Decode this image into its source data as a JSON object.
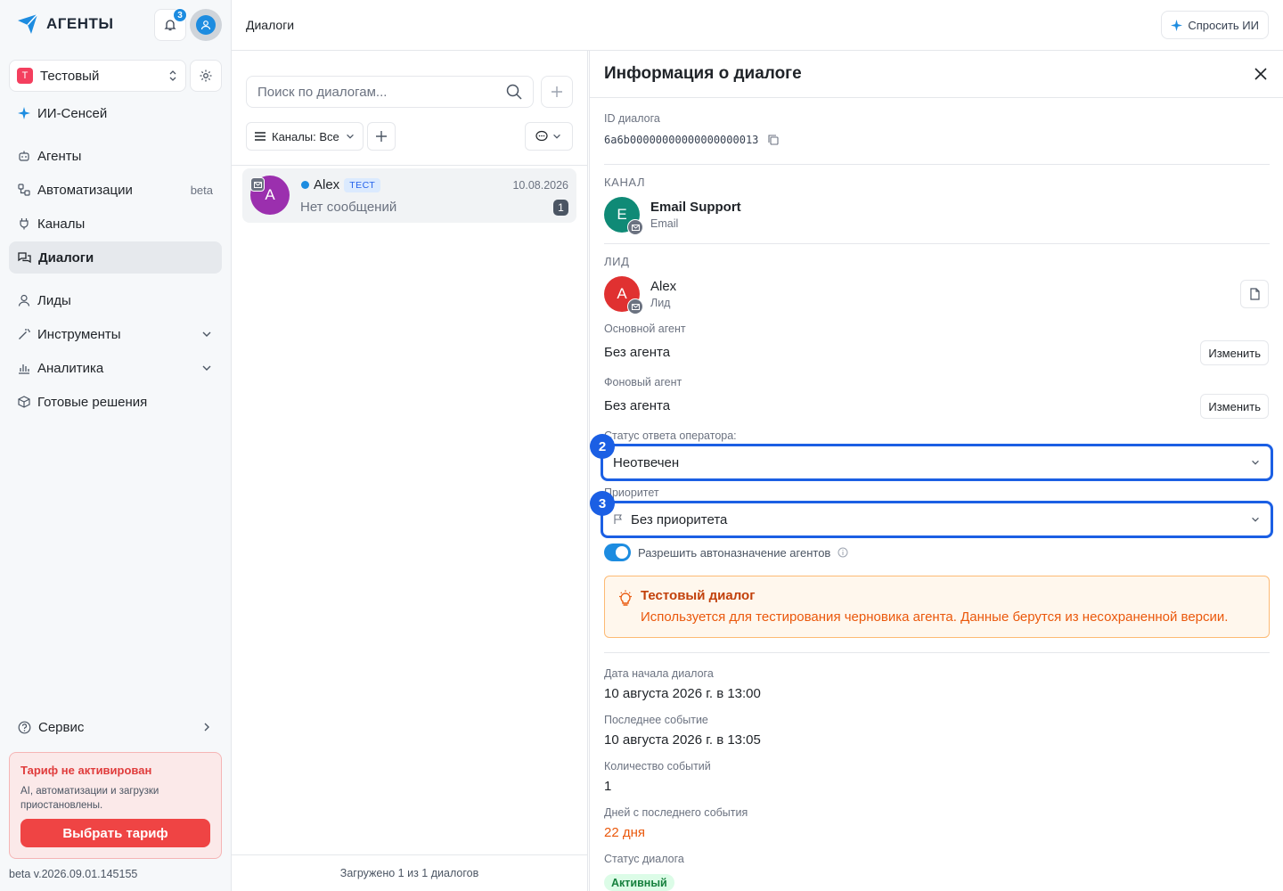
{
  "app": {
    "logo_text": "АГЕНТЫ",
    "notifications_count": "3"
  },
  "workspace": {
    "badge": "T",
    "name": "Тестовый"
  },
  "nav": {
    "ai_sensei": "ИИ-Сенсей",
    "agents": "Агенты",
    "automations": "Автоматизации",
    "automations_tag": "beta",
    "channels": "Каналы",
    "dialogs": "Диалоги",
    "leads": "Лиды",
    "tools": "Инструменты",
    "analytics": "Аналитика",
    "solutions": "Готовые решения",
    "service": "Сервис"
  },
  "plan": {
    "title": "Тариф не активирован",
    "desc": "AI, автоматизации и загрузки приостановлены.",
    "button": "Выбрать тариф"
  },
  "version": "beta v.2026.09.01.145155",
  "header": {
    "breadcrumb": "Диалоги",
    "ask_ai": "Спросить ИИ"
  },
  "list": {
    "search_placeholder": "Поиск по диалогам...",
    "channels_filter": "Каналы: Все",
    "footer": "Загружено 1 из 1 диалогов",
    "items": [
      {
        "initial": "A",
        "name": "Alex",
        "tag": "ТЕСТ",
        "date": "10.08.2026",
        "preview": "Нет сообщений",
        "count": "1"
      }
    ]
  },
  "details": {
    "title": "Информация о диалоге",
    "id_label": "ID диалога",
    "id_value": "6a6b00000000000000000013",
    "channel_section": "КАНАЛ",
    "channel": {
      "initial": "E",
      "name": "Email Support",
      "type": "Email"
    },
    "lead_section": "ЛИД",
    "lead": {
      "initial": "A",
      "name": "Alex",
      "type": "Лид"
    },
    "main_agent_label": "Основной агент",
    "main_agent_value": "Без агента",
    "bg_agent_label": "Фоновый агент",
    "bg_agent_value": "Без агента",
    "change_label": "Изменить",
    "operator_status_label": "Статус ответа оператора:",
    "operator_status_value": "Неотвечен",
    "priority_label": "Приоритет",
    "priority_value": "Без приоритета",
    "badge_2": "2",
    "badge_3": "3",
    "auto_assign_label": "Разрешить автоназначение агентов",
    "auto_assign_on": true,
    "info_title": "Тестовый диалог",
    "info_desc": "Используется для тестирования черновика агента. Данные берутся из несохраненной версии.",
    "start_label": "Дата начала диалога",
    "start_value": "10 августа 2026 г. в 13:00",
    "last_event_label": "Последнее событие",
    "last_event_value": "10 августа 2026 г. в 13:05",
    "events_count_label": "Количество событий",
    "events_count_value": "1",
    "days_since_label": "Дней с последнего события",
    "days_since_value": "22 дня",
    "status_label": "Статус диалога",
    "status_value": "Активный"
  },
  "colors": {
    "accent": "#1d8ce0",
    "highlight": "#1b5fe4",
    "danger": "#ef4444",
    "lead_avatar": "#e03131",
    "channel_avatar": "#0f8a76",
    "conv_avatar": "#9b2fae"
  }
}
